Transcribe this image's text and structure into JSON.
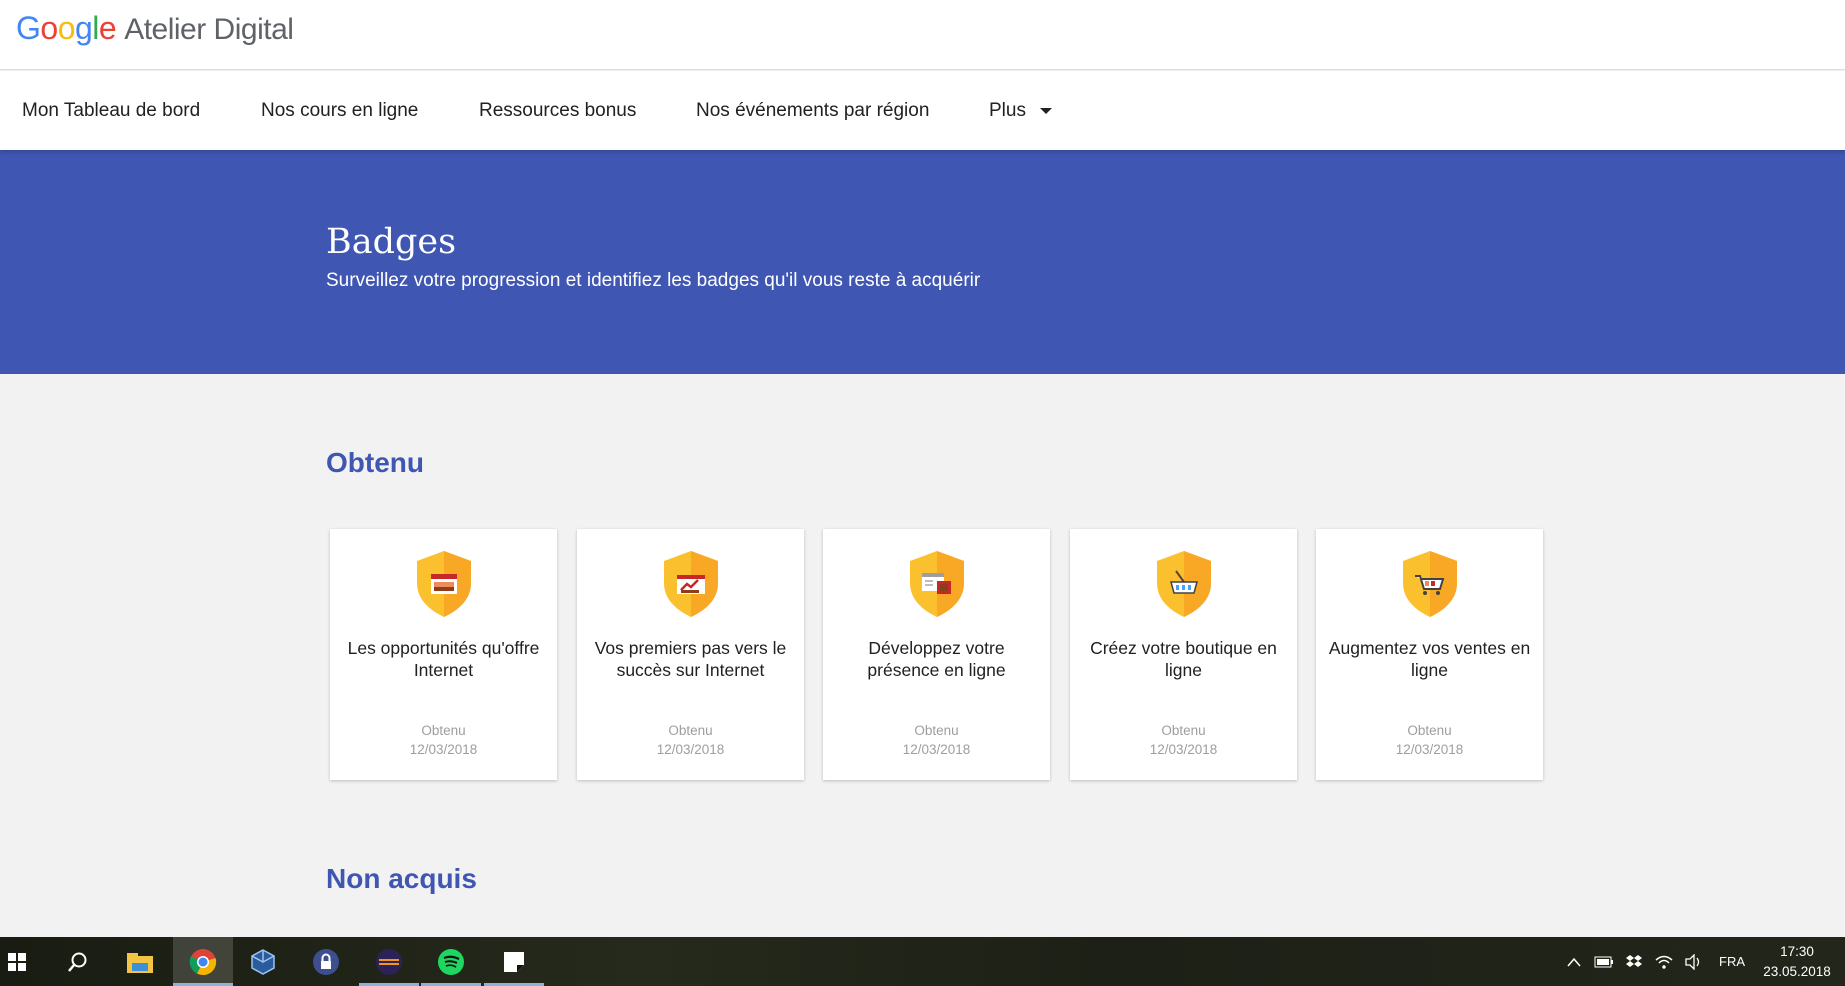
{
  "logo": {
    "brand": "Google",
    "product": "Atelier Digital"
  },
  "nav": {
    "items": [
      "Mon Tableau de bord",
      "Nos cours en ligne",
      "Ressources bonus",
      "Nos événements par région"
    ],
    "more_label": "Plus"
  },
  "hero": {
    "title": "Badges",
    "subtitle": "Surveillez votre progression et identifiez les badges qu'il vous reste à acquérir"
  },
  "sections": {
    "earned": "Obtenu",
    "not_earned": "Non acquis"
  },
  "badges": [
    {
      "name": "Les opportunités qu'offre Internet",
      "status": "Obtenu",
      "date": "12/03/2018",
      "icon": "webpage-icon"
    },
    {
      "name": "Vos premiers pas vers le succès sur Internet",
      "status": "Obtenu",
      "date": "12/03/2018",
      "icon": "growth-icon"
    },
    {
      "name": "Développez votre présence en ligne",
      "status": "Obtenu",
      "date": "12/03/2018",
      "icon": "presence-icon"
    },
    {
      "name": "Créez votre boutique en ligne",
      "status": "Obtenu",
      "date": "12/03/2018",
      "icon": "basket-icon"
    },
    {
      "name": "Augmentez vos ventes en ligne",
      "status": "Obtenu",
      "date": "12/03/2018",
      "icon": "cart-icon"
    }
  ],
  "taskbar": {
    "apps": [
      "start-icon",
      "search-icon",
      "file-explorer-icon",
      "chrome-icon",
      "virtualbox-icon",
      "keepass-icon",
      "eclipse-icon",
      "spotify-icon",
      "sticky-notes-icon"
    ],
    "language": "FRA",
    "time": "17:30",
    "date": "23.05.2018"
  },
  "colors": {
    "primary": "#3f56b3",
    "badge_gold": "#fbc02d",
    "background": "#f2f2f2"
  }
}
